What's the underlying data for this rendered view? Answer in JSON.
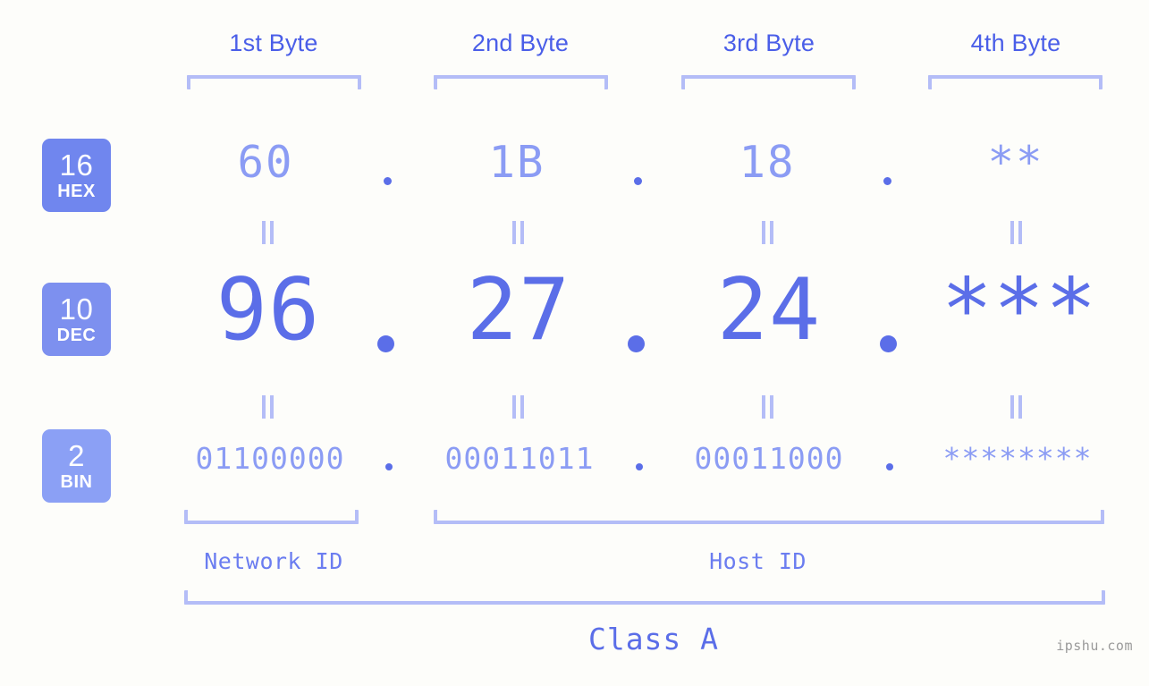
{
  "byte_headers": [
    {
      "label": "1st Byte"
    },
    {
      "label": "2nd Byte"
    },
    {
      "label": "3rd Byte"
    },
    {
      "label": "4th Byte"
    }
  ],
  "bases": [
    {
      "num": "16",
      "abbr": "HEX"
    },
    {
      "num": "10",
      "abbr": "DEC"
    },
    {
      "num": "2",
      "abbr": "BIN"
    }
  ],
  "rows": {
    "hex": {
      "values": [
        "60",
        "1B",
        "18",
        "**"
      ]
    },
    "dec": {
      "values": [
        "96",
        "27",
        "24",
        "***"
      ]
    },
    "bin": {
      "values": [
        "01100000",
        "00011011",
        "00011000",
        "********"
      ]
    }
  },
  "separator": ".",
  "equality_mark": "=",
  "sections": {
    "network_id": "Network ID",
    "host_id": "Host ID"
  },
  "class_label": "Class A",
  "watermark": "ipshu.com",
  "colors": {
    "background": "#fdfdfa",
    "accent_strong": "#5b6ee8",
    "accent_mid": "#7086ee",
    "accent_light": "#8b9cf4",
    "bracket": "#b4bdf7",
    "header_text": "#4a5ee8",
    "watermark": "#9a9a9a"
  }
}
